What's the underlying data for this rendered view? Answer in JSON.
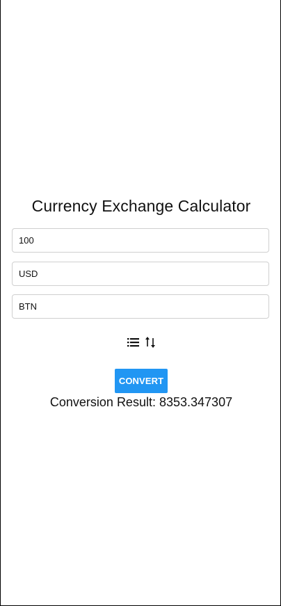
{
  "app": {
    "title": "Currency Exchange Calculator"
  },
  "form": {
    "amount_value": "100",
    "from_currency_value": "USD",
    "to_currency_value": "BTN"
  },
  "icons": {
    "list": "list-icon",
    "swap": "swap-vertical-icon"
  },
  "actions": {
    "convert_label": "CONVERT"
  },
  "result": {
    "label": "Conversion Result:",
    "value": "8353.347307"
  },
  "colors": {
    "accent": "#2196f3",
    "text": "#111111",
    "border": "#cfcfcf"
  }
}
